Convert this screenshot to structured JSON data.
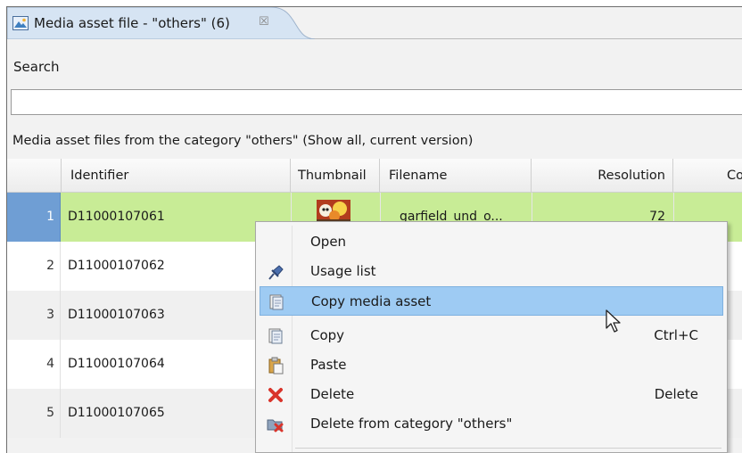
{
  "tab": {
    "title": "Media asset file - \"others\" (6)",
    "close_glyph": "☒",
    "icon": "media-asset-icon"
  },
  "search": {
    "label": "Search",
    "value": "",
    "placeholder": ""
  },
  "caption": "Media asset files from the category \"others\" (Show all, current version)",
  "table": {
    "columns": [
      "Identifier",
      "Thumbnail",
      "Filename",
      "Resolution",
      "Co"
    ],
    "rows": [
      {
        "num": "1",
        "identifier": "D11000107061",
        "filename": "garfield_und_o...",
        "resolution": "72",
        "selected": true
      },
      {
        "num": "2",
        "identifier": "D11000107062",
        "filename": "",
        "resolution": ""
      },
      {
        "num": "3",
        "identifier": "D11000107063",
        "filename": "",
        "resolution": ""
      },
      {
        "num": "4",
        "identifier": "D11000107064",
        "filename": "",
        "resolution": ""
      },
      {
        "num": "5",
        "identifier": "D11000107065",
        "filename": "",
        "resolution": ""
      }
    ]
  },
  "menu": {
    "items": [
      {
        "label": "Open",
        "shortcut": "",
        "icon": ""
      },
      {
        "label": "Usage list",
        "shortcut": "",
        "icon": "pin-icon"
      },
      {
        "label": "Copy media asset",
        "shortcut": "",
        "icon": "copy-icon",
        "highlighted": true
      },
      {
        "label": "Copy",
        "shortcut": "Ctrl+C",
        "icon": "copy-icon"
      },
      {
        "label": "Paste",
        "shortcut": "",
        "icon": "paste-icon"
      },
      {
        "label": "Delete",
        "shortcut": "Delete",
        "icon": "delete-x-icon"
      },
      {
        "label": "Delete from category \"others\"",
        "shortcut": "",
        "icon": "folder-delete-icon"
      }
    ]
  },
  "colors": {
    "selected_row": "#c8ec96",
    "selected_rownum": "#6f9ed4",
    "menu_highlight": "#9ecbf3",
    "delete_red": "#d9342b"
  }
}
